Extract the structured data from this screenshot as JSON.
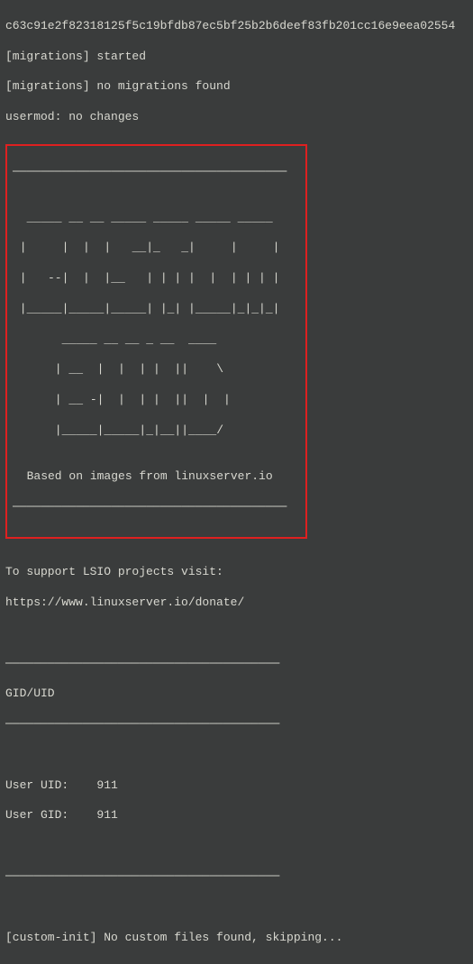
{
  "lines": {
    "hash": "c63c91e2f82318125f5c19bfdb87ec5bf25b2b6deef83fb201cc16e9eea02554",
    "mig_started": "[migrations] started",
    "mig_none": "[migrations] no migrations found",
    "usermod": "usermod: no changes",
    "ascii": [
      "───────────────────────────────────────",
      "",
      "  _____ __ __ _____ _____ _____ _____",
      " |     |  |  |   __|_   _|     |     |",
      " |   --|  |  |__   | | | |  |  | | | |",
      " |_____|_____|_____| |_| |_____|_|_|_|",
      "       _____ __ __ _ __  ____",
      "      | __  |  |  | |  ||    \\",
      "      | __ -|  |  | |  ||  |  |",
      "      |_____|_____|_|__||____/",
      "",
      "  Based on images from linuxserver.io",
      "───────────────────────────────────────"
    ],
    "support": "To support LSIO projects visit:",
    "donate_url": "https://www.linuxserver.io/donate/",
    "divider": "───────────────────────────────────────",
    "giduid": "GID/UID",
    "uid": "User UID:    911",
    "gid": "User GID:    911",
    "custom_init": "[custom-init] No custom files found, skipping..."
  }
}
